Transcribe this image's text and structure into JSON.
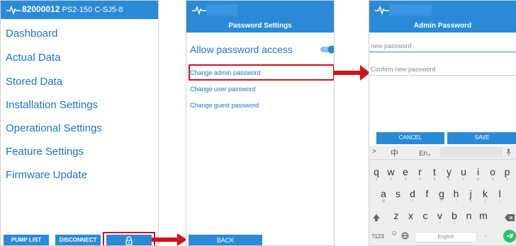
{
  "screen1": {
    "device_id": "82000012",
    "pump_model": "PS2-150 C-SJ5-8",
    "menu": [
      "Dashboard",
      "Actual Data",
      "Stored Data",
      "Installation Settings",
      "Operational Settings",
      "Feature Settings",
      "Firmware Update"
    ],
    "buttons": {
      "pump_list": "PUMP LIST",
      "disconnect": "DISCONNECT"
    },
    "lock_icon": "padlock-icon"
  },
  "screen2": {
    "title": "Password Settings",
    "toggle_label": "Allow password access",
    "toggle_on": true,
    "links": [
      "Change admin password",
      "Change user password",
      "Change guest password"
    ],
    "back_label": "BACK"
  },
  "screen3": {
    "title": "Admin Password",
    "new_password_placeholder": "new password",
    "confirm_password_placeholder": "Confirm new password",
    "cancel_label": "CANCEL",
    "save_label": "SAVE",
    "keyboard": {
      "suggestions": [
        ">",
        "中",
        "En，"
      ],
      "row1": [
        [
          "q",
          "1"
        ],
        [
          "w",
          "2"
        ],
        [
          "e",
          "3"
        ],
        [
          "r",
          "4"
        ],
        [
          "t",
          "5"
        ],
        [
          "y",
          "6"
        ],
        [
          "u",
          "7"
        ],
        [
          "i",
          "8"
        ],
        [
          "o",
          "9"
        ],
        [
          "p",
          "0"
        ]
      ],
      "row2": [
        [
          "a",
          "@"
        ],
        [
          "s",
          "*"
        ],
        [
          "d",
          "+"
        ],
        [
          "f",
          "-"
        ],
        [
          "g",
          "="
        ],
        [
          "h",
          "/"
        ],
        [
          "j",
          "#"
        ],
        [
          "k",
          "("
        ],
        [
          "l",
          ")"
        ]
      ],
      "row3": [
        [
          "z",
          "'"
        ],
        [
          "x",
          ":"
        ],
        [
          "c",
          "\""
        ],
        [
          "v",
          "?"
        ],
        [
          "b",
          "!"
        ],
        [
          "n",
          "~"
        ],
        [
          "m",
          "…"
        ]
      ],
      "symbol_key": "?123",
      "space_label": "English"
    }
  },
  "colors": {
    "accent": "#2a8ad8",
    "callout": "#d1121b"
  }
}
